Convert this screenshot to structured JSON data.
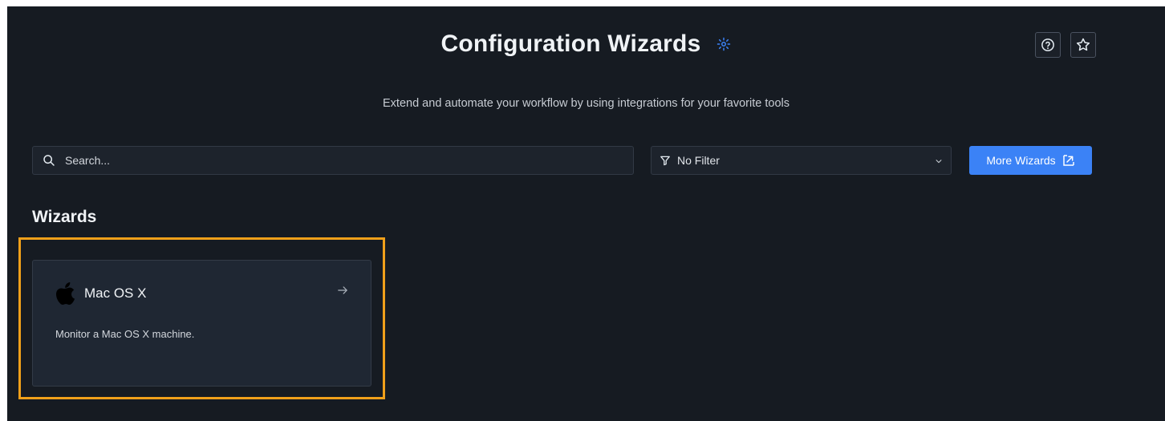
{
  "header": {
    "title": "Configuration Wizards",
    "subtitle": "Extend and automate your workflow by using integrations for your favorite tools"
  },
  "toolbar": {
    "search_placeholder": "Search...",
    "filter_label": "No Filter",
    "more_wizards_label": "More Wizards"
  },
  "section": {
    "heading": "Wizards"
  },
  "wizards": [
    {
      "title": "Mac OS X",
      "description": "Monitor a Mac OS X machine.",
      "icon": "apple-logo-icon"
    }
  ],
  "icons": {
    "title": "gear-icon",
    "help": "question-circle-icon",
    "favorite": "star-icon",
    "search": "search-icon",
    "filter": "funnel-icon",
    "dropdown": "chevron-down-icon",
    "external": "external-link-icon",
    "card_arrow": "arrow-right-icon"
  },
  "colors": {
    "background": "#161b22",
    "card": "#1f2733",
    "accent": "#3b82f6",
    "highlight": "#f0a01a"
  }
}
